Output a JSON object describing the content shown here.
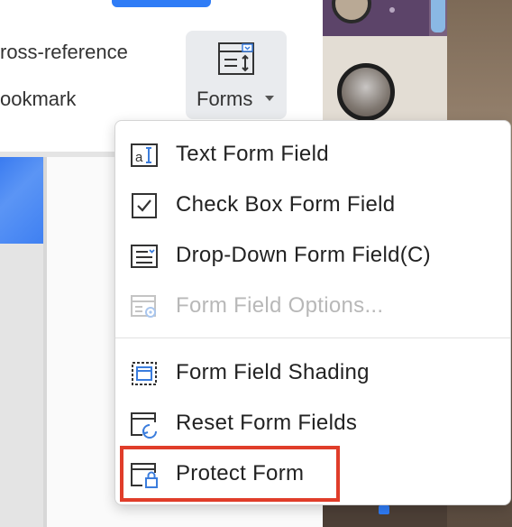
{
  "ribbon": {
    "cross_reference_label": "ross-reference",
    "bookmark_label": "ookmark",
    "forms_label": "Forms"
  },
  "menu": {
    "items": [
      {
        "label": "Text Form Field",
        "icon": "text-form-field-icon",
        "enabled": true
      },
      {
        "label": "Check Box Form Field",
        "icon": "checkbox-icon",
        "enabled": true
      },
      {
        "label": "Drop-Down Form Field(C)",
        "icon": "dropdown-field-icon",
        "enabled": true
      },
      {
        "label": "Form Field Options...",
        "icon": "field-options-icon",
        "enabled": false
      },
      {
        "label": "Form Field Shading",
        "icon": "field-shading-icon",
        "enabled": true
      },
      {
        "label": "Reset Form Fields",
        "icon": "reset-fields-icon",
        "enabled": true
      },
      {
        "label": "Protect Form",
        "icon": "protect-form-icon",
        "enabled": true,
        "highlighted": true
      }
    ]
  },
  "colors": {
    "accent_blue": "#2f7cf6",
    "highlight_red": "#e03d2a",
    "icon_dark": "#333333",
    "icon_blue": "#3b7ddd",
    "disabled_text": "#b8b8b8"
  }
}
